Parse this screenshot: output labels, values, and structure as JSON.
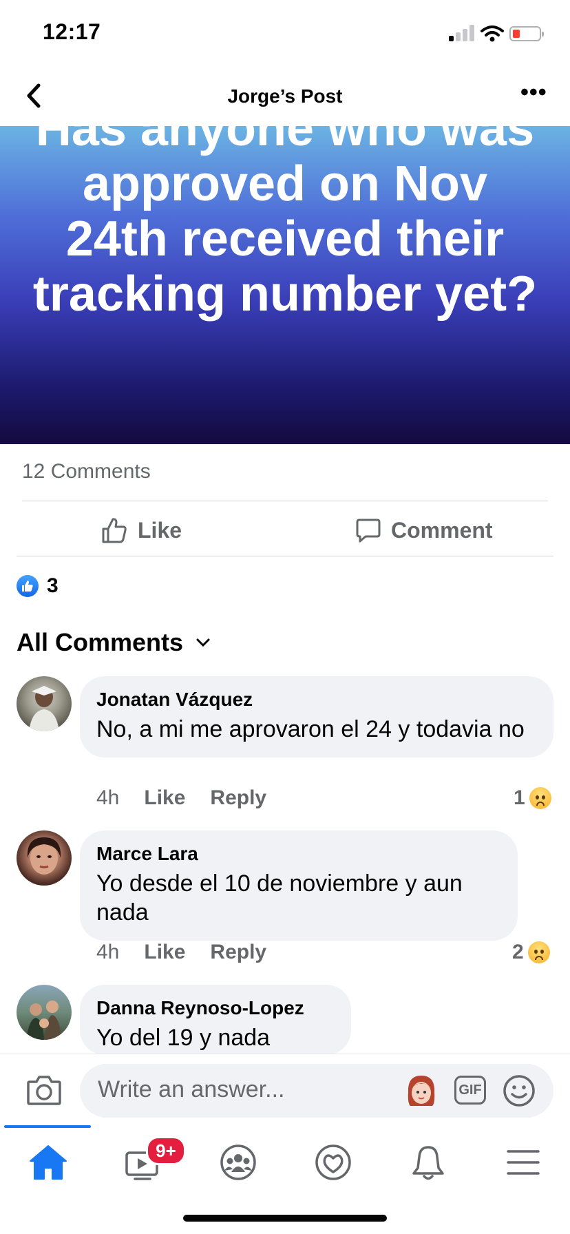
{
  "status": {
    "time": "12:17"
  },
  "nav": {
    "title": "Jorge’s Post"
  },
  "post": {
    "text": "Has anyone who was approved on Nov 24th received their tracking number yet?",
    "comments_count": "12 Comments",
    "like_label": "Like",
    "comment_label": "Comment",
    "reaction_count": "3"
  },
  "comments_header": {
    "label": "All Comments"
  },
  "comments": [
    {
      "name": "Jonatan Vázquez",
      "text": "No, a mi me aprovaron el 24 y todavia no",
      "time": "4h",
      "like": "Like",
      "reply": "Reply",
      "reactions": "1",
      "reaction_type": "sad"
    },
    {
      "name": "Marce Lara",
      "text": "Yo desde el 10 de noviembre y aun nada",
      "time": "4h",
      "like": "Like",
      "reply": "Reply",
      "reactions": "2",
      "reaction_type": "sad"
    },
    {
      "name": "Danna Reynoso-Lopez",
      "text": "Yo del 19 y nada"
    }
  ],
  "composer": {
    "placeholder": "Write an answer...",
    "gif_label": "GIF"
  },
  "tabbar": {
    "items": [
      "home-icon",
      "watch-icon",
      "groups-icon",
      "dating-icon",
      "notifications-icon",
      "menu-icon"
    ],
    "watch_badge": "9+"
  },
  "colors": {
    "accent": "#1877f2",
    "bubble": "#f0f2f5",
    "muted": "#65676b",
    "badge": "#e41e3f"
  }
}
